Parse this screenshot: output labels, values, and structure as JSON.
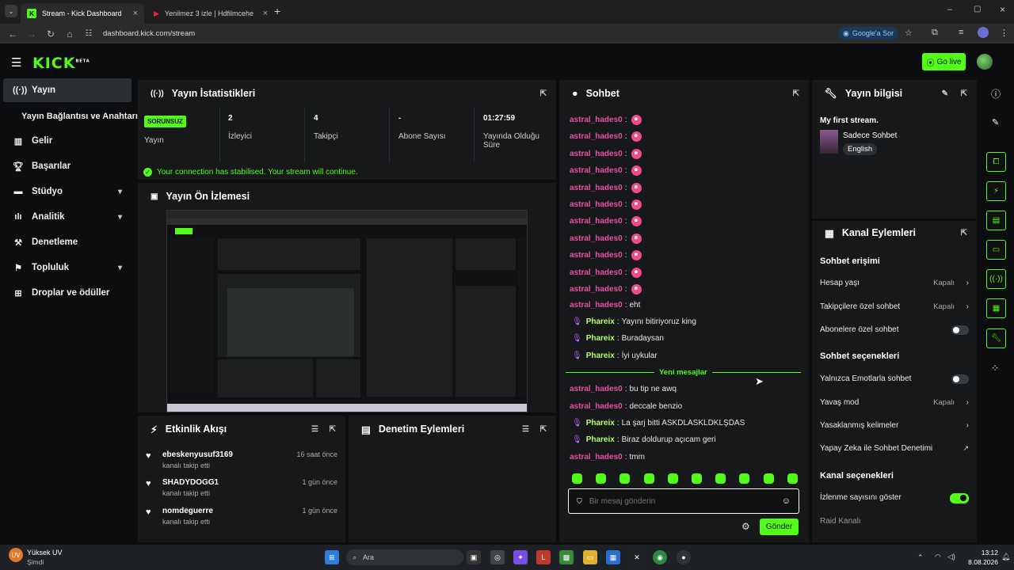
{
  "browser": {
    "tabs": [
      {
        "title": "Stream - Kick Dashboard",
        "active": true
      },
      {
        "title": "Yenilmez 3 izle | Hdfilmcehenne",
        "active": false
      }
    ],
    "url": "dashboard.kick.com/stream",
    "google_btn": "Google'a Sor"
  },
  "header": {
    "logo": "KICK",
    "logo_beta": "BETA",
    "go_live": "Go live"
  },
  "sidebar": {
    "items": [
      {
        "label": "Yayın",
        "icon": "broadcast-icon",
        "active": true
      },
      {
        "label": "Yayın Bağlantısı ve Anahtarı",
        "icon": "",
        "active": false
      },
      {
        "label": "Gelir",
        "icon": "chart-icon",
        "active": false
      },
      {
        "label": "Başarılar",
        "icon": "trophy-icon",
        "active": false
      },
      {
        "label": "Stüdyo",
        "icon": "video-icon",
        "active": false,
        "expandable": true
      },
      {
        "label": "Analitik",
        "icon": "analytics-icon",
        "active": false,
        "expandable": true
      },
      {
        "label": "Denetleme",
        "icon": "hammer-icon",
        "active": false
      },
      {
        "label": "Topluluk",
        "icon": "community-icon",
        "active": false,
        "expandable": true
      },
      {
        "label": "Droplar ve ödüller",
        "icon": "gift-icon",
        "active": false
      }
    ]
  },
  "stats": {
    "title": "Yayın İstatistikleri",
    "status_badge": "SORUNSUZ",
    "status_label": "Yayın",
    "viewers_value": "2",
    "viewers_label": "İzleyici",
    "followers_value": "4",
    "followers_label": "Takipçi",
    "subs_value": "-",
    "subs_label": "Abone Sayısı",
    "uptime_value": "01:27:59",
    "uptime_label_1": "Yayında Olduğu",
    "uptime_label_2": "Süre",
    "connection_msg": "Your connection has stabilised. Your stream will continue."
  },
  "preview": {
    "title": "Yayın Ön İzlemesi"
  },
  "activity": {
    "title": "Etkinlik Akışı",
    "items": [
      {
        "name": "ebeskenyusuf3169",
        "sub": "kanalı takip etti",
        "time": "16 saat önce"
      },
      {
        "name": "SHADYDOGG1",
        "sub": "kanalı takip etti",
        "time": "1 gün önce"
      },
      {
        "name": "nomdeguerre",
        "sub": "kanalı takip etti",
        "time": "1 gün önce"
      }
    ]
  },
  "moderation": {
    "title": "Denetim Eylemleri"
  },
  "chat": {
    "title": "Sohbet",
    "emote_user": "astral_hades0",
    "emote_count": 11,
    "messages": [
      {
        "user": "astral_hades0",
        "text": "eht",
        "mic": false
      },
      {
        "user": "Phareix",
        "text": "Yayını bitiriyoruz king",
        "mic": true
      },
      {
        "user": "Phareix",
        "text": "Buradaysan",
        "mic": true
      },
      {
        "user": "Phareix",
        "text": "İyi uykular",
        "mic": true
      }
    ],
    "new_messages_label": "Yeni mesajlar",
    "new_messages": [
      {
        "user": "astral_hades0",
        "text": "bu tip ne awq",
        "mic": false
      },
      {
        "user": "astral_hades0",
        "text": "deccale benzio",
        "mic": false
      },
      {
        "user": "Phareix",
        "text": "La şarj bitti ASKDLASKLDKLŞDAS",
        "mic": true
      },
      {
        "user": "Phareix",
        "text": "Biraz doldurup açıcam geri",
        "mic": true
      },
      {
        "user": "astral_hades0",
        "text": "tmm",
        "mic": false
      }
    ],
    "input_placeholder": "Bir mesaj gönderin",
    "send_label": "Gönder"
  },
  "stream_info": {
    "title": "Yayın bilgisi",
    "stream_title": "My first stream.",
    "category": "Sadece Sohbet",
    "language": "English"
  },
  "channel_actions": {
    "title": "Kanal Eylemleri",
    "chat_access_title": "Sohbet erişimi",
    "account_age": "Hesap yaşı",
    "account_age_val": "Kapalı",
    "followers_only": "Takipçilere özel sohbet",
    "followers_only_val": "Kapalı",
    "subs_only": "Abonelere özel sohbet",
    "chat_options_title": "Sohbet seçenekleri",
    "emotes_only": "Yalnızca Emotlarla sohbet",
    "slow_mode": "Yavaş mod",
    "slow_mode_val": "Kapalı",
    "banned_words": "Yasaklanmış kelimeler",
    "ai_moderation": "Yapay Zeka ile Sohbet Denetimi",
    "channel_options_title": "Kanal seçenekleri",
    "show_viewers": "İzlenme sayısını göster",
    "raid": "Raid Kanalı"
  },
  "taskbar": {
    "weather_title": "Yüksek UV",
    "weather_sub": "Şimdi",
    "search": "Ara",
    "time": "13:12",
    "date": "8.08.2026"
  },
  "colors": {
    "accent": "#53fc18",
    "username_pink": "#e94fa8",
    "panel": "#161819",
    "bg": "#0b0d0e"
  }
}
